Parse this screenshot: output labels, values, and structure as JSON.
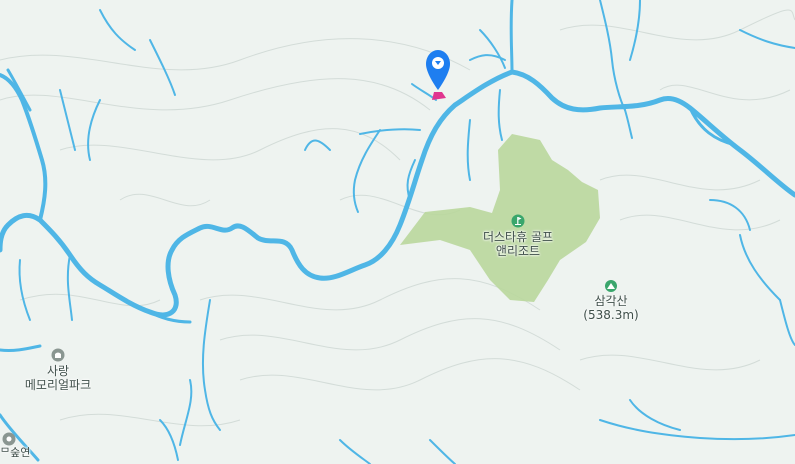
{
  "map": {
    "colors": {
      "background": "#eef3f0",
      "water": "#4fb6e6",
      "park": "#b9d79c",
      "contour": "#d3dcd8",
      "marker": "#1e7ef0",
      "marker_base": "#e0358f"
    },
    "places": {
      "golf": {
        "name_line1": "더스타휴 골프",
        "name_line2": "앤리조트",
        "icon": "golf-icon"
      },
      "mountain": {
        "name": "삼각산",
        "elevation": "(538.3m)",
        "icon": "mountain-peak-icon"
      },
      "memorial": {
        "name_line1": "사랑",
        "name_line2": "메모리얼파크",
        "icon": "memorial-park-icon"
      },
      "partial_bottom_left": {
        "text": "ᄆ숲연"
      }
    },
    "marker": {
      "icon": "location-pin-icon"
    }
  }
}
